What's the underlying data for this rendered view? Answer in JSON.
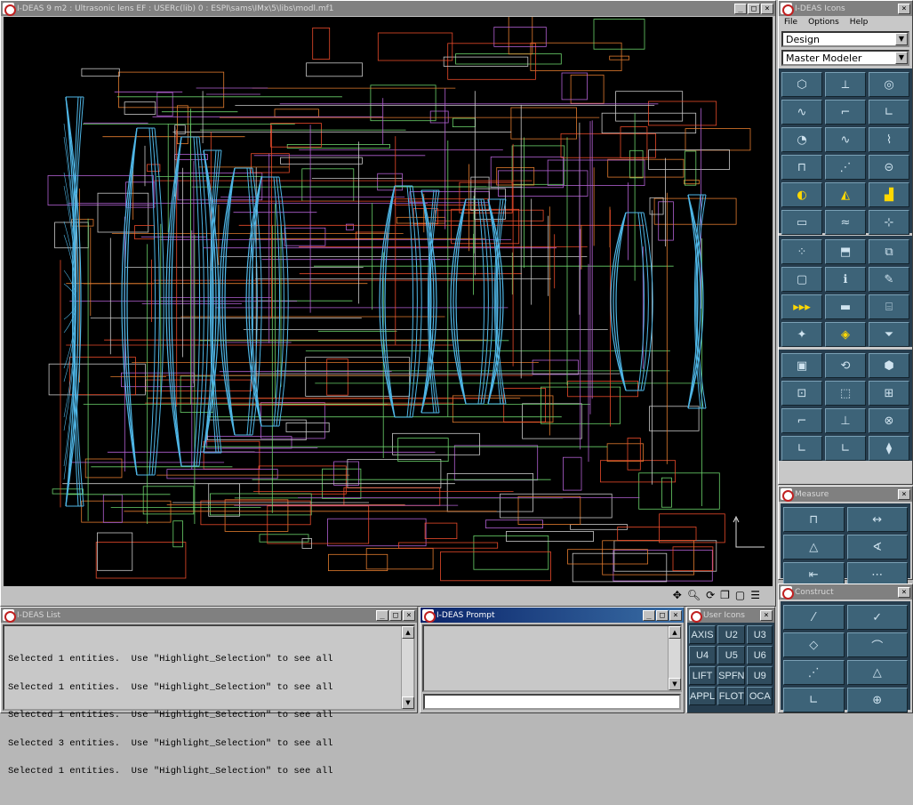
{
  "main_window": {
    "title": "I-DEAS 9 m2 : Ultrasonic lens EF : USERc(lib) 0 : ESPI\\sams\\IMx\\5\\libs\\modl.mf1"
  },
  "graphics": {
    "background": "#000000",
    "wire_colors": [
      "#4fb6e6",
      "#e07a2e",
      "#c8c8c8",
      "#b05fd0",
      "#e84a2a",
      "#6ad06a"
    ]
  },
  "view_toolbar": {
    "icons": [
      "pan-icon",
      "zoom-icon",
      "rotate-icon",
      "view-cube-icon",
      "window-icon",
      "menu-icon"
    ],
    "glyphs": [
      "✥",
      "🔍︎",
      "⟳",
      "❐",
      "▢",
      "☰"
    ]
  },
  "icons_panel": {
    "title": "I-DEAS Icons",
    "menu": [
      "File",
      "Options",
      "Help"
    ],
    "application": "Design",
    "task": "Master Modeler",
    "group1": [
      "⬡",
      "⟂",
      "◎",
      "∿",
      "⌐",
      "∟",
      "◔",
      "∿",
      "⌇",
      "⊓",
      "⋰",
      "⊝",
      "◐",
      "◭",
      "▟",
      "▭",
      "≈",
      "⊹"
    ],
    "group2": [
      "⁘",
      "⬒",
      "⧉",
      "▢",
      "ℹ",
      "✎",
      "▸▸▸",
      "▬",
      "⌸",
      "✦",
      "◈",
      "⏷"
    ],
    "group3": [
      "▣",
      "⟲",
      "⬢",
      "⊡",
      "⬚",
      "⊞",
      "⌐",
      "⊥",
      "⊗",
      "∟",
      "∟",
      "⧫"
    ]
  },
  "measure_panel": {
    "title": "Measure",
    "icons": [
      "⊓",
      "↔",
      "△",
      "∢",
      "⇤",
      "⋯"
    ]
  },
  "construct_panel": {
    "title": "Construct",
    "icons": [
      "⁄",
      "✓",
      "◇",
      "⌒",
      "⋰",
      "△",
      "∟",
      "⊕"
    ]
  },
  "list_window": {
    "title": "I-DEAS List",
    "lines": [
      "Selected 1 entities.  Use \"Highlight_Selection\" to see all",
      "Selected 1 entities.  Use \"Highlight_Selection\" to see all",
      "Selected 1 entities.  Use \"Highlight_Selection\" to see all",
      "Selected 3 entities.  Use \"Highlight_Selection\" to see all",
      "Selected 1 entities.  Use \"Highlight_Selection\" to see all"
    ]
  },
  "prompt_window": {
    "title": "I-DEAS Prompt",
    "input_value": ""
  },
  "user_icons": {
    "title": "User Icons",
    "buttons": [
      "AXIS",
      "U2",
      "U3",
      "U4",
      "U5",
      "U6",
      "LIFT",
      "SPFN",
      "U9",
      "APPL",
      "FLOT",
      "OCA"
    ]
  }
}
